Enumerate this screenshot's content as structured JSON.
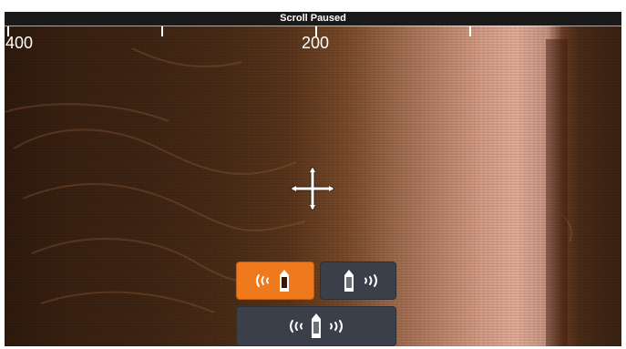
{
  "header": {
    "status": "Scroll Paused"
  },
  "range_scale": {
    "labels": [
      "400",
      "200"
    ]
  },
  "view_buttons": [
    {
      "mode": "left-side",
      "icon": "port-side-scan-icon",
      "active": true
    },
    {
      "mode": "right-side",
      "icon": "starboard-side-scan-icon",
      "active": false
    },
    {
      "mode": "both-sides",
      "icon": "both-sides-scan-icon",
      "active": false
    }
  ],
  "colors": {
    "active_button": "#ef7a1e",
    "inactive_button": "#3a3f4a",
    "title_bar": "#1a1a1a"
  }
}
